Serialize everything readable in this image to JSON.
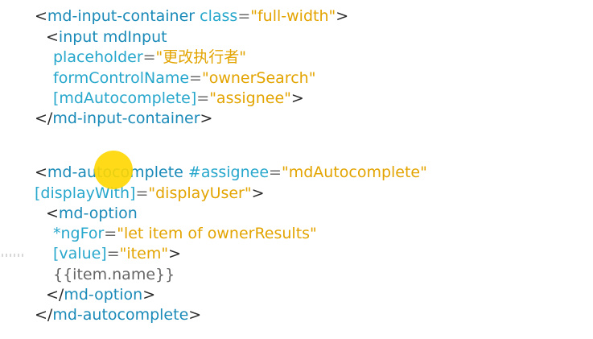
{
  "code": {
    "lines": [
      [
        [
          "<",
          "t"
        ],
        [
          "md-input-container",
          "tag"
        ],
        [
          " ",
          "t"
        ],
        [
          "class",
          "attr"
        ],
        [
          "=",
          "eq"
        ],
        [
          "\"full-width\"",
          "str"
        ],
        [
          ">",
          "t"
        ]
      ],
      [
        [
          "<",
          "t"
        ],
        [
          "input",
          "tag"
        ],
        [
          " ",
          "t"
        ],
        [
          "mdInput",
          "tag"
        ]
      ],
      [
        [
          "placeholder",
          "attr"
        ],
        [
          "=",
          "eq"
        ],
        [
          "\"更改执行者\"",
          "str"
        ]
      ],
      [
        [
          "formControlName",
          "attr"
        ],
        [
          "=",
          "eq"
        ],
        [
          "\"ownerSearch\"",
          "str"
        ]
      ],
      [
        [
          "[mdAutocomplete]",
          "attr"
        ],
        [
          "=",
          "eq"
        ],
        [
          "\"assignee\"",
          "str"
        ],
        [
          ">",
          "t"
        ]
      ],
      [
        [
          "</",
          "t"
        ],
        [
          "md-input-container",
          "tag"
        ],
        [
          ">",
          "t"
        ]
      ],
      [
        [
          "<",
          "t"
        ],
        [
          "md-autocomplete",
          "tag"
        ],
        [
          " ",
          "t"
        ],
        [
          "#assignee",
          "attr"
        ],
        [
          "=",
          "eq"
        ],
        [
          "\"mdAutocomplete\"",
          "str"
        ]
      ],
      [
        [
          "[displayWith]",
          "attr"
        ],
        [
          "=",
          "eq"
        ],
        [
          "\"displayUser\"",
          "str"
        ],
        [
          ">",
          "t"
        ]
      ],
      [
        [
          "<",
          "t"
        ],
        [
          "md-option",
          "tag"
        ]
      ],
      [
        [
          "*ngFor",
          "attr"
        ],
        [
          "=",
          "eq"
        ],
        [
          "\"let item of ownerResults\"",
          "str"
        ]
      ],
      [
        [
          "[value]",
          "attr"
        ],
        [
          "=",
          "eq"
        ],
        [
          "\"item\"",
          "str"
        ],
        [
          ">",
          "t"
        ]
      ],
      [
        [
          "{{item.name}}",
          "plain"
        ]
      ],
      [
        [
          "</",
          "t"
        ],
        [
          "md-option",
          "tag"
        ],
        [
          ">",
          "t"
        ]
      ],
      [
        [
          "</",
          "t"
        ],
        [
          "md-autocomplete",
          "tag"
        ],
        [
          ">",
          "t"
        ]
      ]
    ]
  }
}
